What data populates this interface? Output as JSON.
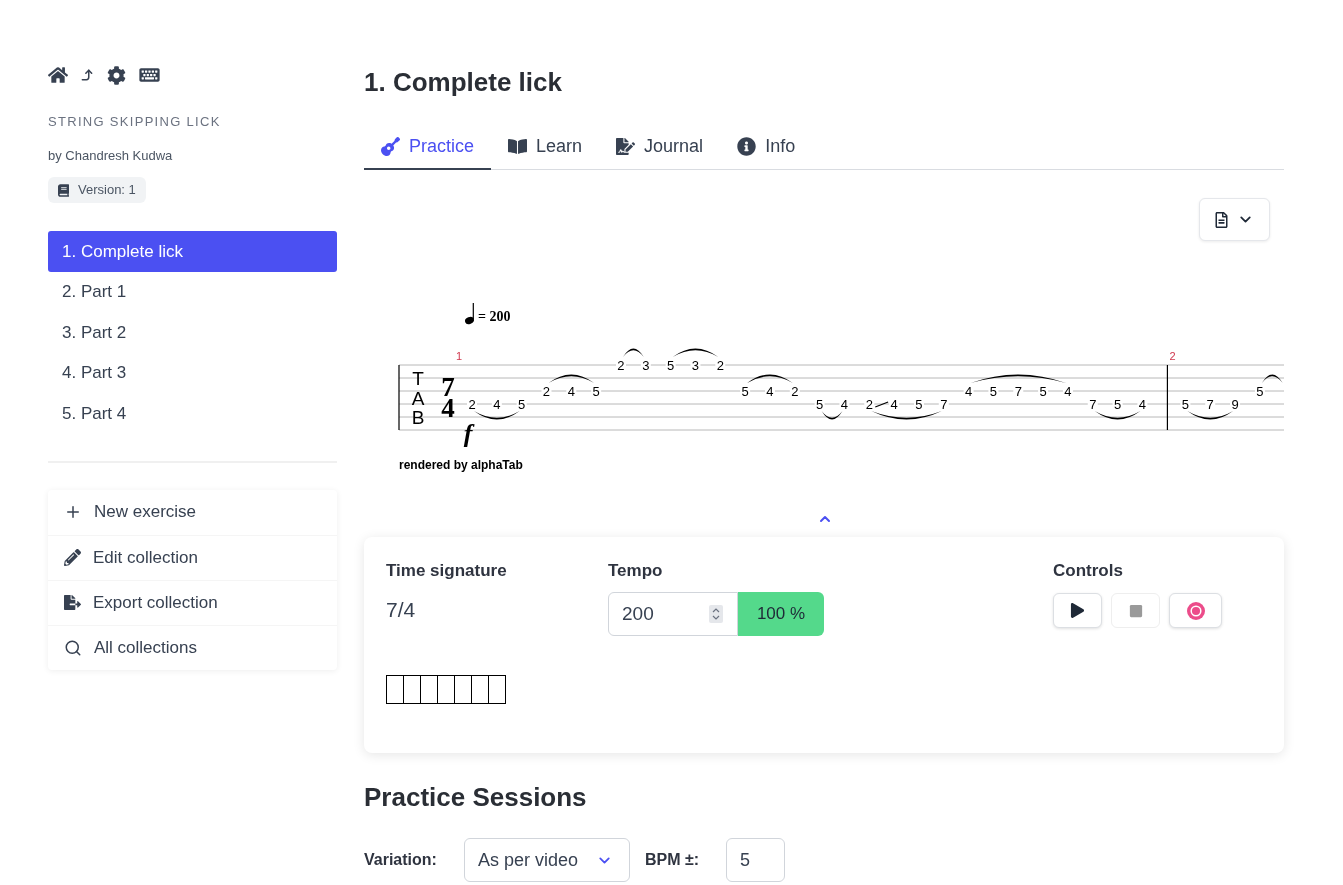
{
  "sidebar": {
    "collection_title": "STRING SKIPPING LICK",
    "author": "by Chandresh Kudwa",
    "version": "Version: 1",
    "exercises": [
      {
        "label": "1. Complete lick",
        "selected": true
      },
      {
        "label": "2. Part 1",
        "selected": false
      },
      {
        "label": "3. Part 2",
        "selected": false
      },
      {
        "label": "4. Part 3",
        "selected": false
      },
      {
        "label": "5. Part 4",
        "selected": false
      }
    ],
    "actions": [
      {
        "label": "New exercise"
      },
      {
        "label": "Edit collection"
      },
      {
        "label": "Export collection"
      },
      {
        "label": "All collections"
      }
    ]
  },
  "main": {
    "title": "1. Complete lick",
    "tabs": [
      {
        "label": "Practice",
        "selected": true
      },
      {
        "label": "Learn",
        "selected": false
      },
      {
        "label": "Journal",
        "selected": false
      },
      {
        "label": "Info",
        "selected": false
      }
    ],
    "notation": {
      "tempo": "= 200",
      "clef": "TAB",
      "time_signature": [
        "7",
        "4"
      ],
      "dynamic": "f",
      "credit": "rendered by alphaTab",
      "measures": [
        {
          "number": "1",
          "groups": [
            {
              "kind": "string4",
              "slur": {
                "kind": "under"
              },
              "notes": [
                {
                  "fret": "2",
                  "kind": "plain"
                },
                {
                  "fret": "4",
                  "kind": "plain"
                },
                {
                  "fret": "5",
                  "kind": "plain"
                }
              ]
            },
            {
              "kind": "string3",
              "slur": {
                "kind": "over"
              },
              "notes": [
                {
                  "fret": "2",
                  "kind": "plain"
                },
                {
                  "fret": "4",
                  "kind": "plain"
                },
                {
                  "fret": "5",
                  "kind": "plain"
                }
              ]
            },
            {
              "kind": "string1",
              "slur": {
                "kind": "over"
              },
              "notes": [
                {
                  "fret": "2",
                  "kind": "plain"
                },
                {
                  "fret": "3",
                  "kind": "plain"
                }
              ]
            },
            {
              "kind": "string1",
              "slur": {
                "kind": "over"
              },
              "notes": [
                {
                  "fret": "5",
                  "kind": "plain"
                },
                {
                  "fret": "3",
                  "kind": "plain"
                },
                {
                  "fret": "2",
                  "kind": "plain"
                }
              ]
            },
            {
              "kind": "string3",
              "slur": {
                "kind": "over"
              },
              "notes": [
                {
                  "fret": "5",
                  "kind": "plain"
                },
                {
                  "fret": "4",
                  "kind": "plain"
                },
                {
                  "fret": "2",
                  "kind": "plain"
                }
              ]
            },
            {
              "kind": "string4",
              "slur": {
                "kind": "under"
              },
              "notes": [
                {
                  "fret": "5",
                  "kind": "plain"
                },
                {
                  "fret": "4",
                  "kind": "plain"
                }
              ]
            },
            {
              "kind": "string4",
              "slur": {
                "kind": "under"
              },
              "notes": [
                {
                  "fret": "2",
                  "kind": "plain"
                },
                {
                  "fret": "4",
                  "kind": "slide"
                },
                {
                  "fret": "5",
                  "kind": "plain"
                },
                {
                  "fret": "7",
                  "kind": "plain"
                }
              ]
            },
            {
              "kind": "string3",
              "slur": {
                "kind": "over"
              },
              "notes": [
                {
                  "fret": "4",
                  "kind": "plain"
                },
                {
                  "fret": "5",
                  "kind": "plain"
                },
                {
                  "fret": "7",
                  "kind": "plain"
                },
                {
                  "fret": "5",
                  "kind": "plain"
                },
                {
                  "fret": "4",
                  "kind": "plain"
                }
              ]
            },
            {
              "kind": "string4",
              "slur": {
                "kind": "under"
              },
              "notes": [
                {
                  "fret": "7",
                  "kind": "plain"
                },
                {
                  "fret": "5",
                  "kind": "plain"
                },
                {
                  "fret": "4",
                  "kind": "plain"
                }
              ]
            }
          ]
        },
        {
          "number": "2",
          "groups": [
            {
              "kind": "string4",
              "slur": {
                "kind": "under"
              },
              "notes": [
                {
                  "fret": "5",
                  "kind": "plain"
                },
                {
                  "fret": "7",
                  "kind": "plain"
                },
                {
                  "fret": "9",
                  "kind": "plain"
                }
              ]
            },
            {
              "kind": "string3",
              "slur": {
                "kind": "over"
              },
              "notes": [
                {
                  "fret": "5",
                  "kind": "plain"
                }
              ]
            }
          ]
        }
      ]
    },
    "player": {
      "time_signature": {
        "label": "Time signature",
        "value": "7/4",
        "beats": [
          {
            "active": false
          },
          {
            "active": false
          },
          {
            "active": false
          },
          {
            "active": false
          },
          {
            "active": false
          },
          {
            "active": false
          },
          {
            "active": false
          }
        ]
      },
      "tempo": {
        "label": "Tempo",
        "value": "200",
        "percent": "100 %"
      },
      "controls": {
        "label": "Controls",
        "buttons": [
          {
            "disabled": false
          },
          {
            "disabled": true
          },
          {
            "disabled": false
          }
        ]
      }
    },
    "practice_sessions": {
      "title": "Practice Sessions",
      "variation": {
        "label": "Variation:",
        "value": "As per video"
      },
      "bpm": {
        "label": "BPM ±:",
        "value": "5"
      }
    }
  }
}
